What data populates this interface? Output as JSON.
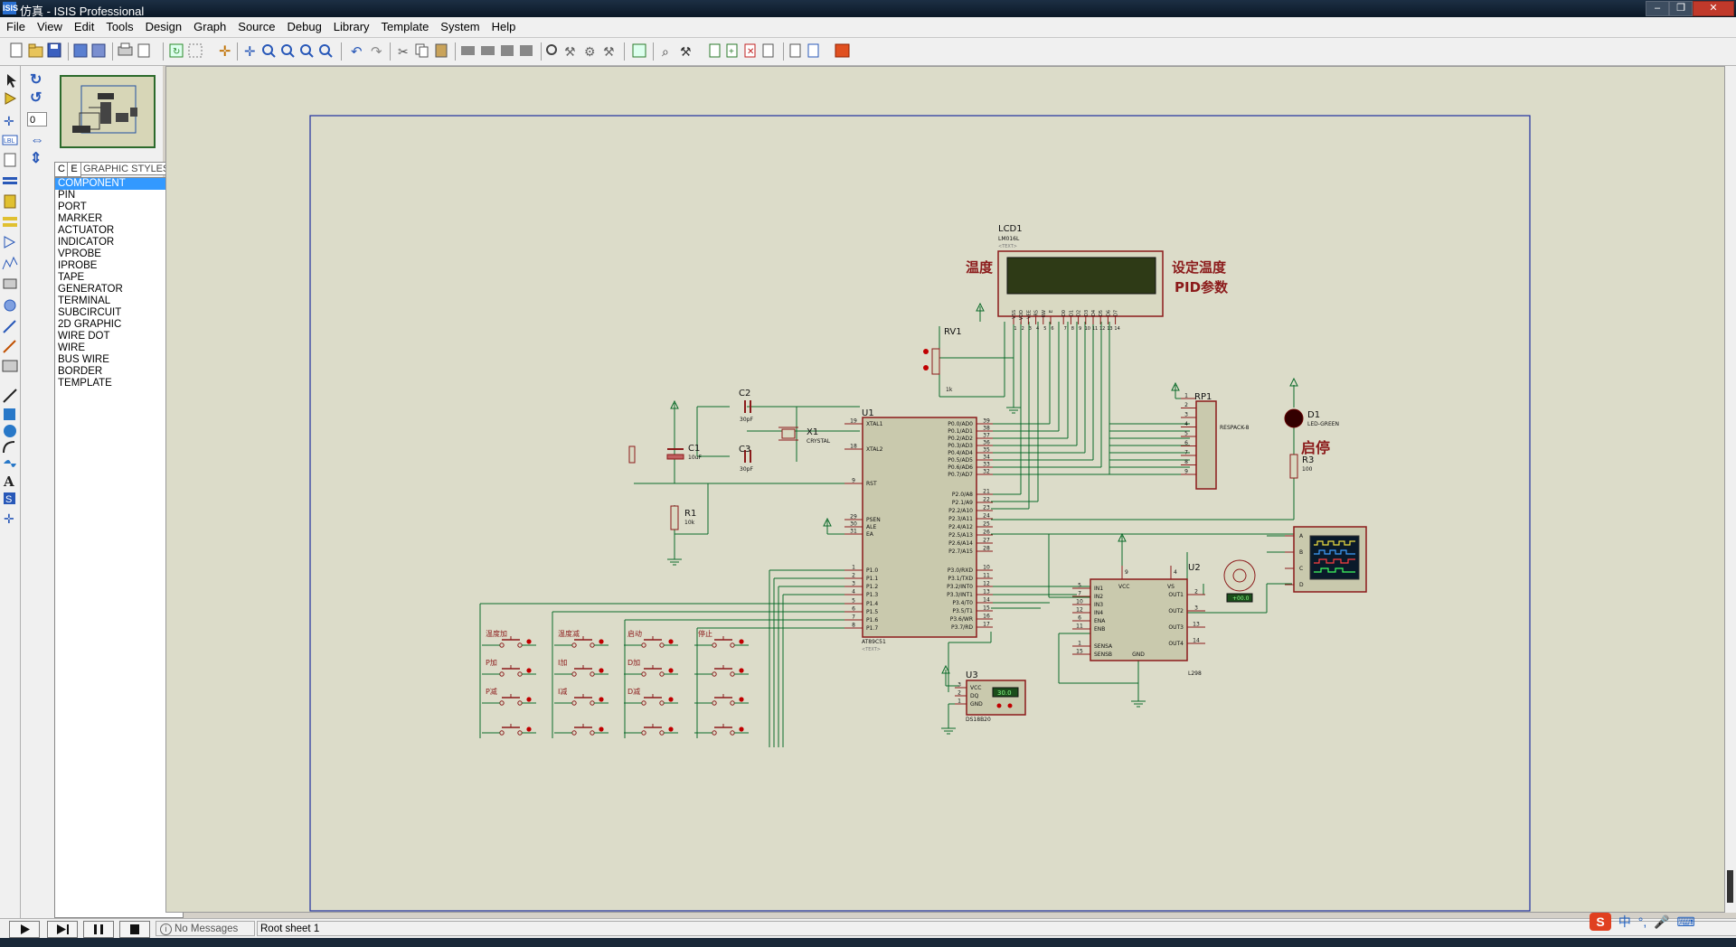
{
  "window": {
    "title": "仿真 - ISIS Professional",
    "app_icon": "ISIS"
  },
  "menu": [
    "File",
    "View",
    "Edit",
    "Tools",
    "Design",
    "Graph",
    "Source",
    "Debug",
    "Library",
    "Template",
    "System",
    "Help"
  ],
  "left_panel": {
    "angle_value": "0",
    "mode_tabs": [
      "C",
      "E"
    ],
    "list_header": "GRAPHIC STYLES",
    "styles": [
      "COMPONENT",
      "PIN",
      "PORT",
      "MARKER",
      "ACTUATOR",
      "INDICATOR",
      "VPROBE",
      "IPROBE",
      "TAPE",
      "GENERATOR",
      "TERMINAL",
      "SUBCIRCUIT",
      "2D GRAPHIC",
      "WIRE DOT",
      "WIRE",
      "BUS WIRE",
      "BORDER",
      "TEMPLATE"
    ],
    "selected_style": "COMPONENT"
  },
  "status": {
    "messages": "No Messages",
    "sheet": "Root sheet 1"
  },
  "tray": {
    "ime": "中",
    "ime_punct": "°,"
  },
  "schematic": {
    "lcd": {
      "ref": "LCD1",
      "part": "LM016L",
      "text": "<TEXT>",
      "pins": [
        "VSS",
        "VDD",
        "VEE",
        "RS",
        "RW",
        "E",
        "D0",
        "D1",
        "D2",
        "D3",
        "D4",
        "D5",
        "D6",
        "D7"
      ],
      "pin_nums": [
        "1",
        "2",
        "3",
        "4",
        "5",
        "6",
        "7",
        "8",
        "9",
        "10",
        "11",
        "12",
        "13",
        "14"
      ]
    },
    "lcd_label_left": "温度",
    "lcd_label_right1": "设定温度",
    "lcd_label_right2": "PID参数",
    "rv1": {
      "ref": "RV1",
      "val": "1k",
      "text": "<TEXT>"
    },
    "u1": {
      "ref": "U1",
      "part": "AT89C51",
      "text": "<TEXT>",
      "left_pins": [
        [
          "19",
          "XTAL1"
        ],
        [
          "18",
          "XTAL2"
        ],
        [
          "9",
          "RST"
        ],
        [
          "29",
          "PSEN"
        ],
        [
          "30",
          "ALE"
        ],
        [
          "31",
          "EA"
        ],
        [
          "1",
          "P1.0"
        ],
        [
          "2",
          "P1.1"
        ],
        [
          "3",
          "P1.2"
        ],
        [
          "4",
          "P1.3"
        ],
        [
          "5",
          "P1.4"
        ],
        [
          "6",
          "P1.5"
        ],
        [
          "7",
          "P1.6"
        ],
        [
          "8",
          "P1.7"
        ]
      ],
      "right_pins": [
        [
          "39",
          "P0.0/AD0"
        ],
        [
          "38",
          "P0.1/AD1"
        ],
        [
          "37",
          "P0.2/AD2"
        ],
        [
          "36",
          "P0.3/AD3"
        ],
        [
          "35",
          "P0.4/AD4"
        ],
        [
          "34",
          "P0.5/AD5"
        ],
        [
          "33",
          "P0.6/AD6"
        ],
        [
          "32",
          "P0.7/AD7"
        ],
        [
          "21",
          "P2.0/A8"
        ],
        [
          "22",
          "P2.1/A9"
        ],
        [
          "23",
          "P2.2/A10"
        ],
        [
          "24",
          "P2.3/A11"
        ],
        [
          "25",
          "P2.4/A12"
        ],
        [
          "26",
          "P2.5/A13"
        ],
        [
          "27",
          "P2.6/A14"
        ],
        [
          "28",
          "P2.7/A15"
        ],
        [
          "10",
          "P3.0/RXD"
        ],
        [
          "11",
          "P3.1/TXD"
        ],
        [
          "12",
          "P3.2/INT0"
        ],
        [
          "13",
          "P3.3/INT1"
        ],
        [
          "14",
          "P3.4/T0"
        ],
        [
          "15",
          "P3.5/T1"
        ],
        [
          "16",
          "P3.6/WR"
        ],
        [
          "17",
          "P3.7/RD"
        ]
      ]
    },
    "c1": {
      "ref": "C1",
      "val": "10uF",
      "text": "<TEXT>"
    },
    "c2": {
      "ref": "C2",
      "val": "30pF",
      "text": "<TEXT>"
    },
    "c3": {
      "ref": "C3",
      "val": "30pF",
      "text": "<TEXT>"
    },
    "x1": {
      "ref": "X1",
      "val": "CRYSTAL",
      "text": "<TEXT>"
    },
    "r1": {
      "ref": "R1",
      "val": "10k",
      "text": "<TEXT>"
    },
    "rp1": {
      "ref": "RP1",
      "part": "RESPACK-8",
      "text": "<TEXT>",
      "pins": [
        "1",
        "2",
        "3",
        "4",
        "5",
        "6",
        "7",
        "8",
        "9"
      ]
    },
    "d1": {
      "ref": "D1",
      "part": "LED-GREEN",
      "text": "<TEXT>"
    },
    "r3": {
      "ref": "R3",
      "val": "100",
      "text": "<TEXT>"
    },
    "start_stop_label": "启停",
    "u2": {
      "ref": "U2",
      "part": "L298",
      "text": "<TEXT>",
      "left_pins": [
        [
          "5",
          "IN1"
        ],
        [
          "7",
          "IN2"
        ],
        [
          "10",
          "IN3"
        ],
        [
          "12",
          "IN4"
        ],
        [
          "6",
          "ENA"
        ],
        [
          "11",
          "ENB"
        ],
        [
          "1",
          "SENSA"
        ],
        [
          "15",
          "SENSB"
        ]
      ],
      "right_pins": [
        [
          "2",
          "OUT1"
        ],
        [
          "3",
          "OUT2"
        ],
        [
          "13",
          "OUT3"
        ],
        [
          "14",
          "OUT4"
        ]
      ],
      "top_pins": [
        [
          "9",
          "VCC"
        ],
        [
          "4",
          "VS"
        ]
      ],
      "gnd": "GND"
    },
    "motor_readout": "+00.0",
    "scope_channels": [
      "A",
      "B",
      "C",
      "D"
    ],
    "u3": {
      "ref": "U3",
      "part": "DS18B20",
      "text": "<TEXT>",
      "pins": [
        [
          "3",
          "VCC"
        ],
        [
          "2",
          "DQ"
        ],
        [
          "1",
          "GND"
        ]
      ],
      "readout": "30.0"
    },
    "keys": [
      [
        "温度加",
        "温度减",
        "启动",
        "停止"
      ],
      [
        "P加",
        "I加",
        "D加",
        ""
      ],
      [
        "P减",
        "I减",
        "D减",
        ""
      ],
      [
        "",
        "",
        "",
        ""
      ]
    ]
  }
}
